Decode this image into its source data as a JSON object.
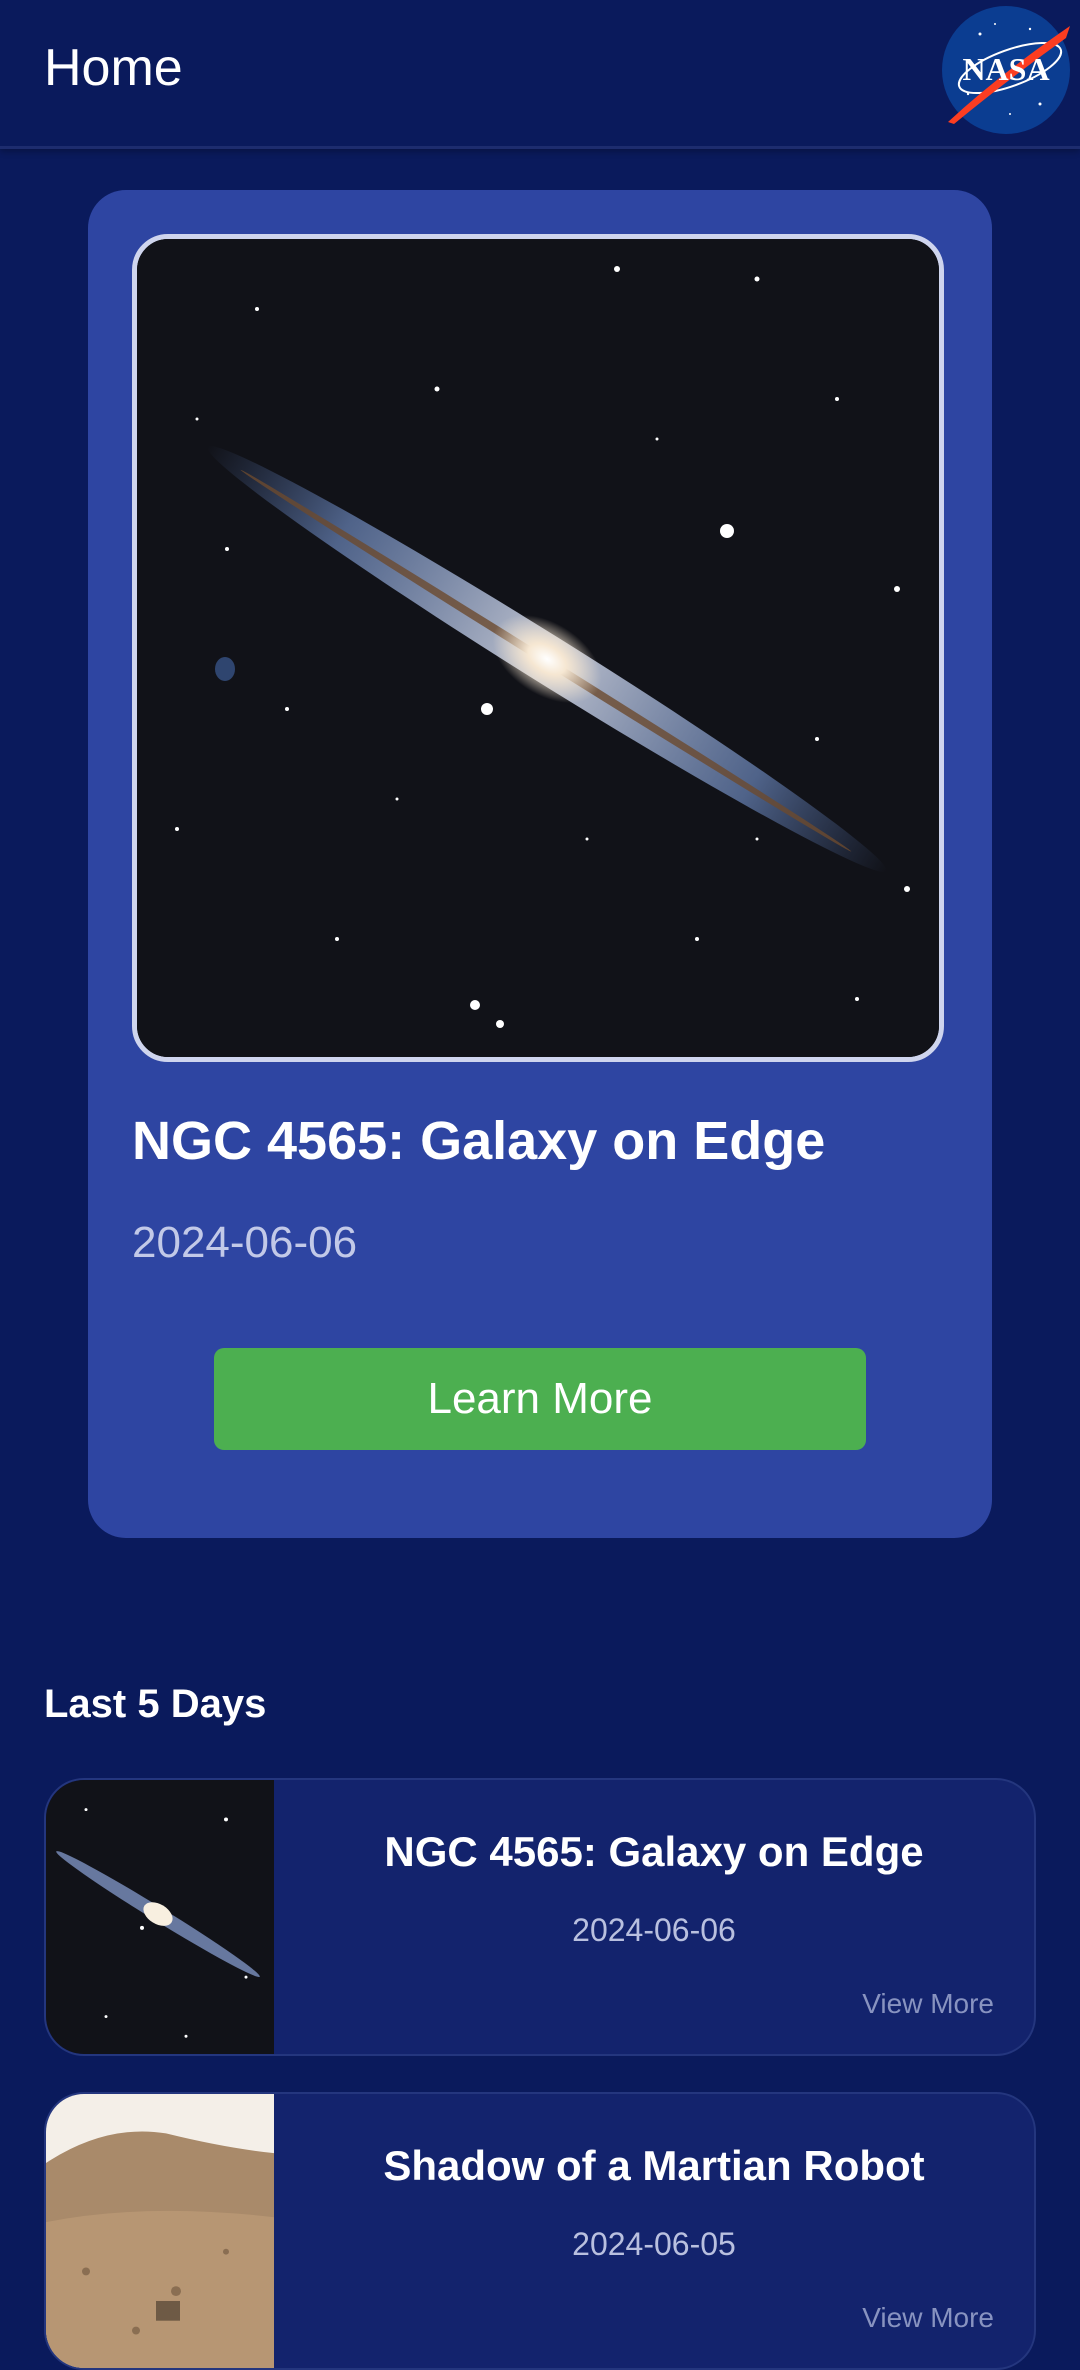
{
  "appbar": {
    "title": "Home",
    "logo_text": "NASA"
  },
  "featured": {
    "title": "NGC 4565: Galaxy on Edge",
    "date": "2024-06-06",
    "button_label": "Learn More"
  },
  "recent": {
    "heading": "Last 5 Days",
    "items": [
      {
        "title": "NGC 4565: Galaxy on Edge",
        "date": "2024-06-06",
        "link": "View More"
      },
      {
        "title": "Shadow of a Martian Robot",
        "date": "2024-06-05",
        "link": "View More"
      }
    ]
  },
  "colors": {
    "background": "#0a1a5c",
    "card": "#2e45a2",
    "button": "#4caf50",
    "list_card": "#13236d"
  }
}
